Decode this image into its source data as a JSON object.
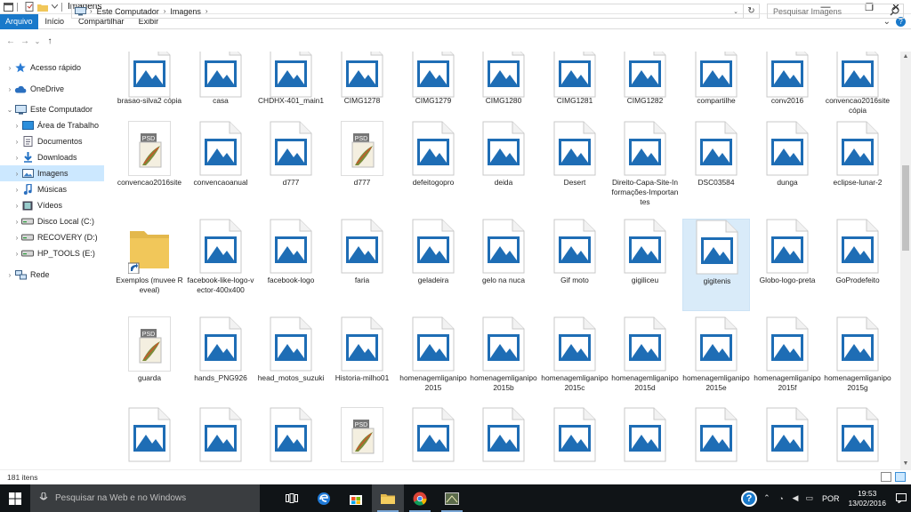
{
  "window": {
    "title": "Imagens",
    "controls": {
      "minimize": "—",
      "maximize": "❐",
      "close": "✕"
    }
  },
  "ribbon": {
    "tabs": [
      "Arquivo",
      "Início",
      "Compartilhar",
      "Exibir"
    ],
    "collapse_glyph": "⌄",
    "help_glyph": "?"
  },
  "address": {
    "back_glyph": "←",
    "forward_glyph": "→",
    "recent_glyph": "⌄",
    "up_glyph": "↑",
    "crumbs": [
      "Este Computador",
      "Imagens"
    ],
    "crumb_sep": "›",
    "dropdown_glyph": "⌄",
    "refresh_glyph": "↻"
  },
  "search": {
    "placeholder": "Pesquisar Imagens"
  },
  "nav": {
    "items": [
      {
        "label": "Acesso rápido",
        "icon": "star-icon",
        "chev": "›"
      },
      {
        "label": "OneDrive",
        "icon": "cloud-icon",
        "chev": "›"
      },
      {
        "label": "Este Computador",
        "icon": "computer-icon",
        "chev": "⌄"
      },
      {
        "label": "Área de Trabalho",
        "icon": "desktop-folder-icon",
        "chev": "›"
      },
      {
        "label": "Documentos",
        "icon": "documents-icon",
        "chev": "›"
      },
      {
        "label": "Downloads",
        "icon": "downloads-icon",
        "chev": "›"
      },
      {
        "label": "Imagens",
        "icon": "pictures-icon",
        "chev": "›"
      },
      {
        "label": "Músicas",
        "icon": "music-icon",
        "chev": "›"
      },
      {
        "label": "Vídeos",
        "icon": "videos-icon",
        "chev": "›"
      },
      {
        "label": "Disco Local (C:)",
        "icon": "drive-icon",
        "chev": "›"
      },
      {
        "label": "RECOVERY (D:)",
        "icon": "drive-icon",
        "chev": "›"
      },
      {
        "label": "HP_TOOLS (E:)",
        "icon": "drive-icon",
        "chev": "›"
      },
      {
        "label": "Rede",
        "icon": "network-icon",
        "chev": "›"
      }
    ]
  },
  "files": [
    {
      "name": "brasao-silva2 cópia",
      "kind": "image"
    },
    {
      "name": "casa",
      "kind": "image"
    },
    {
      "name": "CHDHX-401_main1",
      "kind": "image"
    },
    {
      "name": "CIMG1278",
      "kind": "image"
    },
    {
      "name": "CIMG1279",
      "kind": "image"
    },
    {
      "name": "CIMG1280",
      "kind": "image"
    },
    {
      "name": "CIMG1281",
      "kind": "image"
    },
    {
      "name": "CIMG1282",
      "kind": "image"
    },
    {
      "name": "compartilhe",
      "kind": "image"
    },
    {
      "name": "conv2016",
      "kind": "image"
    },
    {
      "name": "convencao2016site cópia",
      "kind": "image"
    },
    {
      "name": "convencao2016site",
      "kind": "psd"
    },
    {
      "name": "convencaoanual",
      "kind": "image"
    },
    {
      "name": "d777",
      "kind": "image"
    },
    {
      "name": "d777",
      "kind": "psd"
    },
    {
      "name": "defeitogopro",
      "kind": "image"
    },
    {
      "name": "deida",
      "kind": "image"
    },
    {
      "name": "Desert",
      "kind": "image"
    },
    {
      "name": "Direito-Capa-Site-Informações-Importantes",
      "kind": "image"
    },
    {
      "name": "DSC03584",
      "kind": "image"
    },
    {
      "name": "dunga",
      "kind": "image"
    },
    {
      "name": "eclipse-lunar-2",
      "kind": "image"
    },
    {
      "name": "Exemplos (muvee Reveal)",
      "kind": "folder"
    },
    {
      "name": "facebook-like-logo-vector-400x400",
      "kind": "image"
    },
    {
      "name": "facebook-logo",
      "kind": "image"
    },
    {
      "name": "faria",
      "kind": "image"
    },
    {
      "name": "geladeira",
      "kind": "image"
    },
    {
      "name": "gelo na nuca",
      "kind": "image"
    },
    {
      "name": "Gif moto",
      "kind": "image"
    },
    {
      "name": "gigiliceu",
      "kind": "image"
    },
    {
      "name": "gigitenis",
      "kind": "image",
      "selected": true
    },
    {
      "name": "Globo-logo-preta",
      "kind": "image"
    },
    {
      "name": "GoProdefeito",
      "kind": "image"
    },
    {
      "name": "guarda",
      "kind": "psd"
    },
    {
      "name": "hands_PNG926",
      "kind": "image"
    },
    {
      "name": "head_motos_suzuki",
      "kind": "image"
    },
    {
      "name": "Historia-milho01",
      "kind": "image"
    },
    {
      "name": "homenagemliganipo2015",
      "kind": "image"
    },
    {
      "name": "homenagemliganipo2015b",
      "kind": "image"
    },
    {
      "name": "homenagemliganipo2015c",
      "kind": "image"
    },
    {
      "name": "homenagemliganipo2015d",
      "kind": "image"
    },
    {
      "name": "homenagemliganipo2015e",
      "kind": "image"
    },
    {
      "name": "homenagemliganipo2015f",
      "kind": "image"
    },
    {
      "name": "homenagemliganipo2015g",
      "kind": "image"
    },
    {
      "name": "",
      "kind": "image"
    },
    {
      "name": "",
      "kind": "image"
    },
    {
      "name": "",
      "kind": "image"
    },
    {
      "name": "",
      "kind": "psd"
    },
    {
      "name": "",
      "kind": "image"
    },
    {
      "name": "",
      "kind": "image"
    },
    {
      "name": "",
      "kind": "image"
    },
    {
      "name": "",
      "kind": "image"
    },
    {
      "name": "",
      "kind": "image"
    },
    {
      "name": "",
      "kind": "image"
    },
    {
      "name": "",
      "kind": "image"
    }
  ],
  "status": {
    "count": "181 itens"
  },
  "taskbar": {
    "search_placeholder": "Pesquisar na Web e no Windows",
    "apps": [
      "task-view-icon",
      "edge-icon",
      "store-icon",
      "file-explorer-icon",
      "chrome-icon",
      "app-icon"
    ],
    "tray": {
      "help": "?",
      "lang": "POR",
      "time": "19:53",
      "date": "13/02/2016"
    }
  },
  "colors": {
    "accent": "#1979ca",
    "image_icon_blue": "#1e6db5",
    "folder_yellow": "#f1c75a",
    "selection": "#cce8ff",
    "taskbar": "#101417"
  }
}
